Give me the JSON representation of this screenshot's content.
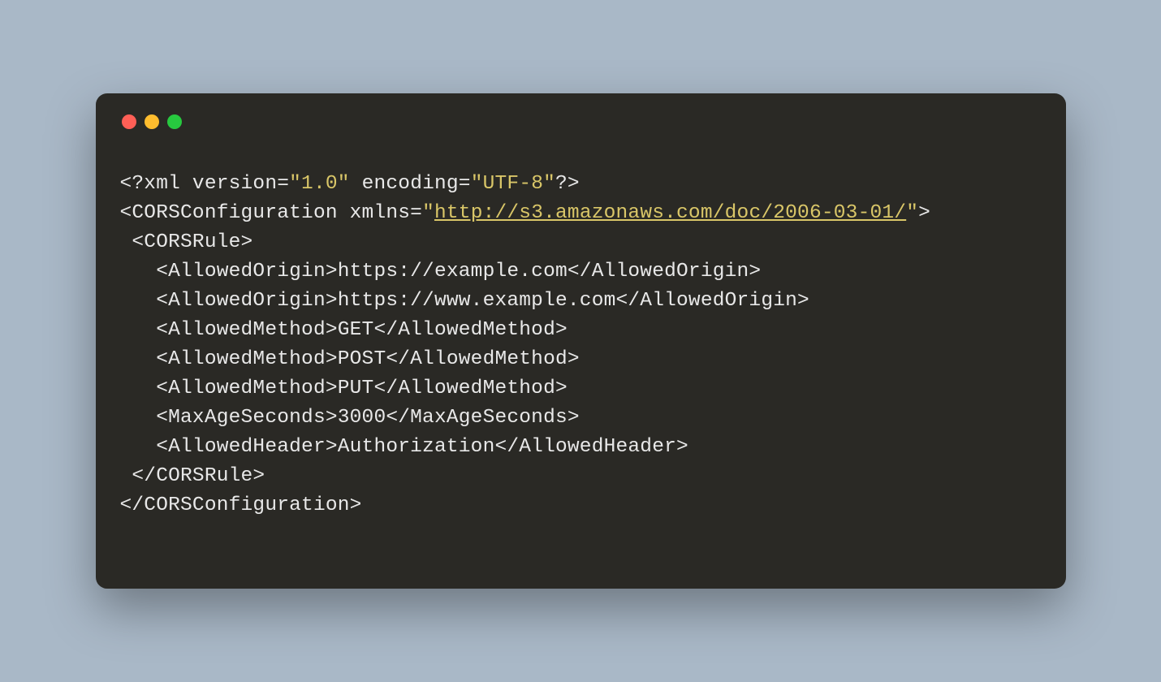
{
  "code": {
    "line1_pre": "<?xml ",
    "line1_version_attr": "version=",
    "line1_version_val": "\"1.0\"",
    "line1_mid": " ",
    "line1_encoding_attr": "encoding=",
    "line1_encoding_val": "\"UTF-8\"",
    "line1_end": "?>",
    "line2_pre": "<CORSConfiguration ",
    "line2_xmlns_attr": "xmlns=",
    "line2_xmlns_quote1": "\"",
    "line2_xmlns_url": "http://s3.amazonaws.com/doc/2006-03-01/",
    "line2_xmlns_quote2": "\"",
    "line2_end": ">",
    "line3": " <CORSRule>",
    "line4": "   <AllowedOrigin>https://example.com</AllowedOrigin>",
    "line5": "   <AllowedOrigin>https://www.example.com</AllowedOrigin>",
    "line6": "   <AllowedMethod>GET</AllowedMethod>",
    "line7": "   <AllowedMethod>POST</AllowedMethod>",
    "line8": "   <AllowedMethod>PUT</AllowedMethod>",
    "line9": "   <MaxAgeSeconds>3000</MaxAgeSeconds>",
    "line10": "   <AllowedHeader>Authorization</AllowedHeader>",
    "line11": " </CORSRule>",
    "line12": "</CORSConfiguration>"
  }
}
